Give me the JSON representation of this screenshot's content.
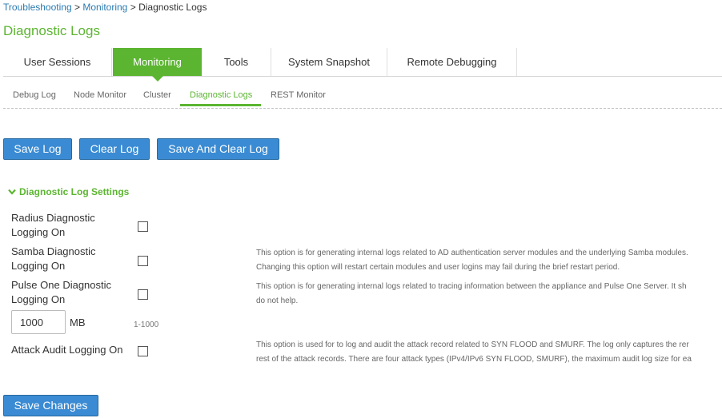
{
  "breadcrumb": {
    "items": [
      "Troubleshooting",
      "Monitoring",
      "Diagnostic Logs"
    ],
    "separator": ">"
  },
  "page_title": "Diagnostic Logs",
  "main_tabs": [
    {
      "label": "User Sessions",
      "active": false
    },
    {
      "label": "Monitoring",
      "active": true
    },
    {
      "label": "Tools",
      "active": false
    },
    {
      "label": "System Snapshot",
      "active": false
    },
    {
      "label": "Remote Debugging",
      "active": false
    }
  ],
  "sub_tabs": [
    {
      "label": "Debug Log",
      "active": false
    },
    {
      "label": "Node Monitor",
      "active": false
    },
    {
      "label": "Cluster",
      "active": false
    },
    {
      "label": "Diagnostic Logs",
      "active": true
    },
    {
      "label": "REST Monitor",
      "active": false
    }
  ],
  "actions": {
    "save_log": "Save Log",
    "clear_log": "Clear Log",
    "save_and_clear": "Save And Clear Log"
  },
  "settings": {
    "header": "Diagnostic Log Settings",
    "radius": {
      "label": "Radius Diagnostic Logging On",
      "checked": false
    },
    "samba": {
      "label": "Samba Diagnostic Logging On",
      "checked": false,
      "desc_line1": "This option is for generating internal logs related to AD authentication server modules and the underlying Samba modules.",
      "desc_line2": "Changing this option will restart certain modules and user logins may fail during the brief restart period."
    },
    "pulse_one": {
      "label": "Pulse One Diagnostic Logging On",
      "checked": false,
      "desc_line1": "This option is for generating internal logs related to tracing information between the appliance and Pulse One Server. It sh",
      "desc_line2": "do not help."
    },
    "log_size": {
      "value": "1000",
      "unit": "MB",
      "range": "1-1000"
    },
    "attack_audit": {
      "label": "Attack Audit Logging On",
      "checked": false,
      "desc_line1": "This option is used for to log and audit the attack record related to SYN FLOOD and SMURF. The log only captures the rer",
      "desc_line2": "rest of the attack records. There are four attack types (IPv4/IPv6 SYN FLOOD, SMURF), the maximum audit log size for ea"
    }
  },
  "save_changes": "Save Changes",
  "colors": {
    "accent_green": "#5cb531",
    "button_blue": "#3a8bd3",
    "link_blue": "#2a7ab0"
  }
}
